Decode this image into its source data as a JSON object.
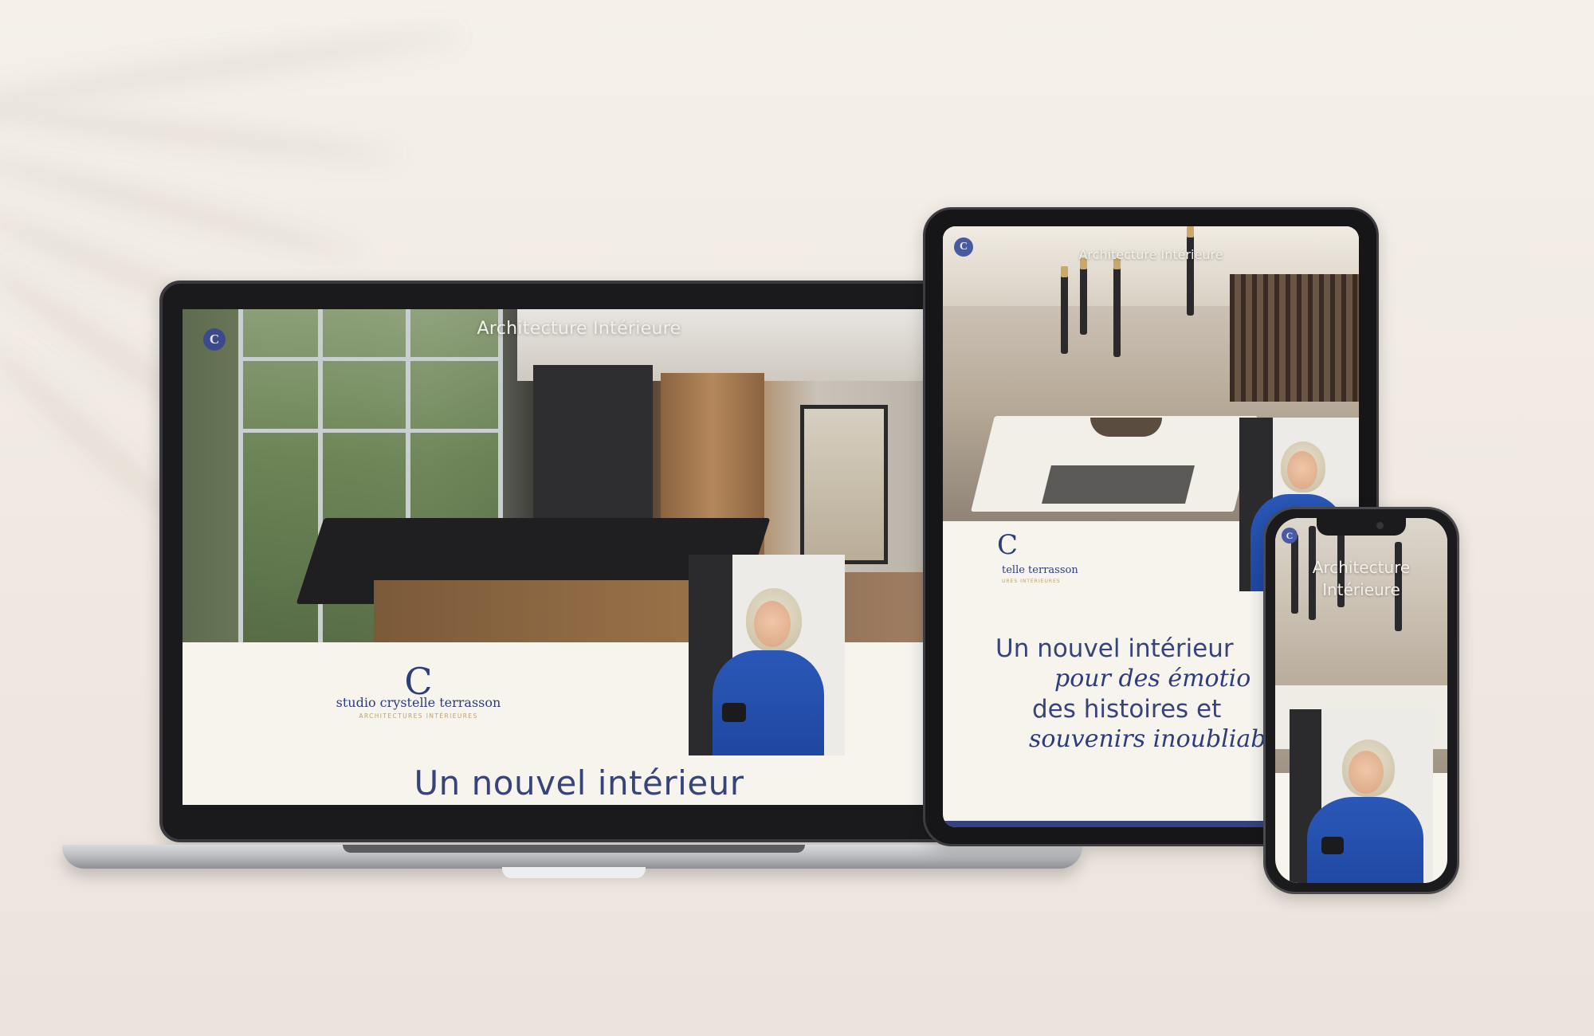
{
  "laptop": {
    "site_title": "Architecture Intérieure",
    "logo_letter": "C",
    "brand_name": "studio crystelle terrasson",
    "brand_tagline": "ARCHITECTURES INTÉRIEURES",
    "headline": "Un nouvel intérieur"
  },
  "tablet": {
    "site_title": "Architecture Intérieure",
    "logo_letter": "C",
    "brand_name": "telle terrasson",
    "brand_tagline": "URES INTÉRIEURES",
    "headline_lines": [
      "Un nouvel intérieur",
      "pour des émotio",
      "des histoires et",
      "souvenirs inoubliab"
    ]
  },
  "phone": {
    "site_title": "Architecture Intérieure",
    "logo_letter": "C"
  },
  "colors": {
    "navy": "#2d3c7a",
    "gold": "#c0a06a",
    "cream": "#f7f4ee",
    "blouse_blue": "#2a58b8"
  },
  "icons": [
    "logo-c-icon",
    "hamburger-menu-icon"
  ]
}
